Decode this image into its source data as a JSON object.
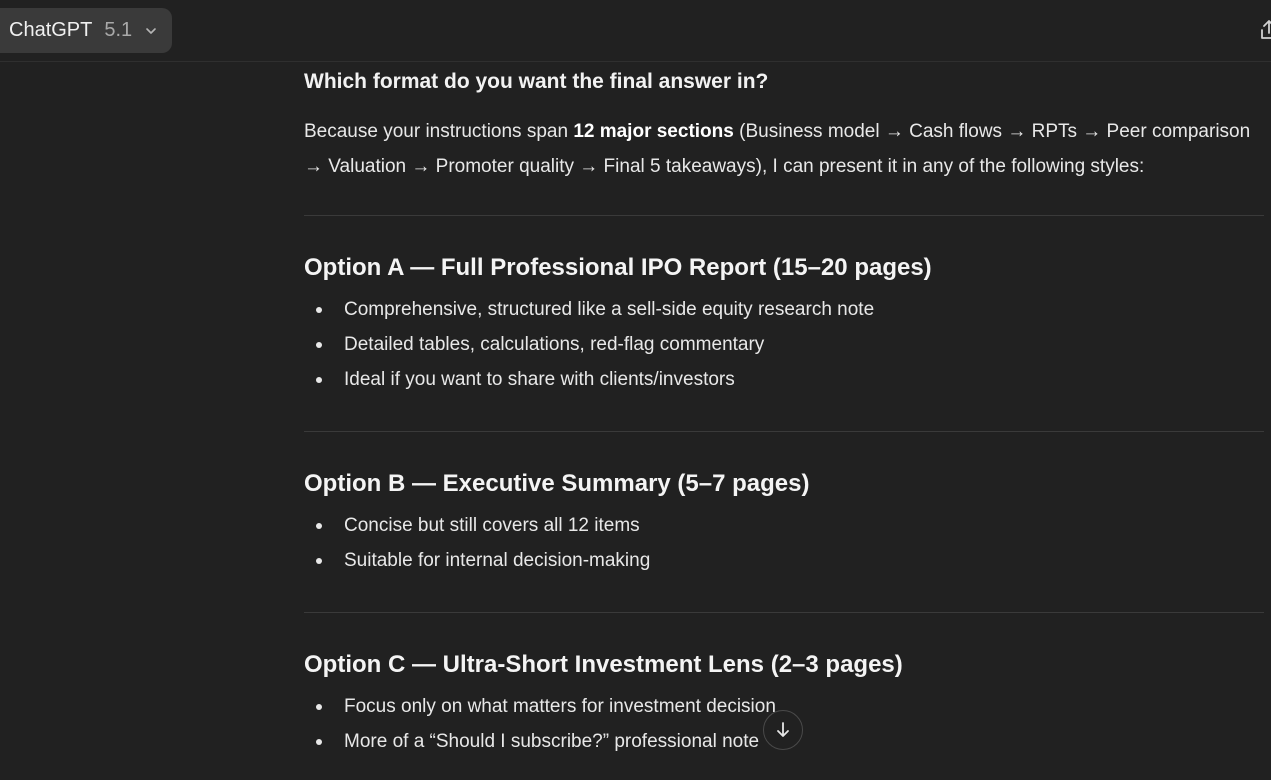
{
  "header": {
    "model_name": "ChatGPT",
    "model_version": "5.1"
  },
  "message": {
    "heading": "Which format do you want the final answer in?",
    "intro_before": "Because your instructions span ",
    "intro_bold": "12 major sections",
    "intro_after": " (Business model → Cash flows → RPTs → Peer comparison → Valuation → Promoter quality → Final 5 takeaways), I can present it in any of the following styles:",
    "options": [
      {
        "title": "Option A — Full Professional IPO Report (15–20 pages)",
        "bullets": [
          "Comprehensive, structured like a sell-side equity research note",
          "Detailed tables, calculations, red-flag commentary",
          "Ideal if you want to share with clients/investors"
        ]
      },
      {
        "title": "Option B — Executive Summary (5–7 pages)",
        "bullets": [
          "Concise but still covers all 12 items",
          "Suitable for internal decision-making"
        ]
      },
      {
        "title": "Option C — Ultra-Short Investment Lens (2–3 pages)",
        "bullets": [
          "Focus only on what matters for investment decision",
          "More of a “Should I subscribe?” professional note"
        ]
      }
    ]
  },
  "icons": {
    "model_dropdown": "chevron-down-icon",
    "share": "share-icon",
    "scroll_down": "arrow-down-icon"
  },
  "colors": {
    "background": "#212121",
    "model_button_bg": "#3a3a3a",
    "text": "#ececec",
    "muted_text": "#a9a9a9",
    "divider": "#3a3a3a"
  }
}
